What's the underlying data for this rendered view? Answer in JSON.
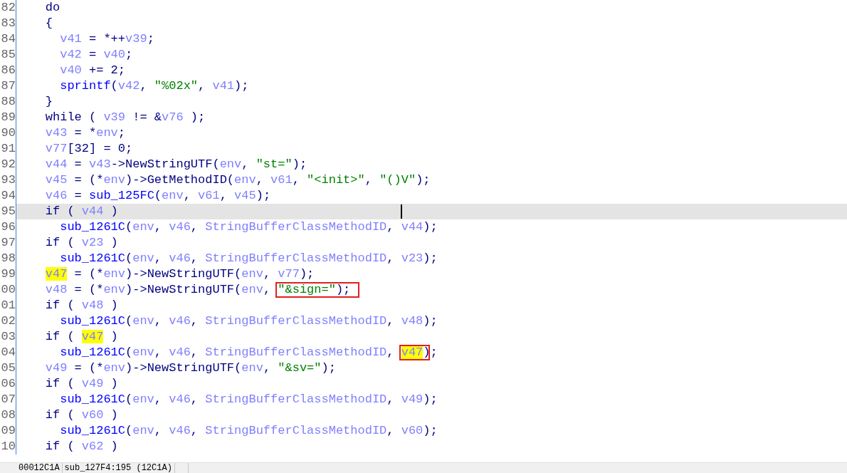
{
  "lines": [
    {
      "number": "82",
      "kind": "outer",
      "current": false,
      "tokens": [
        {
          "kind": "plain",
          "text": "do"
        }
      ]
    },
    {
      "number": "83",
      "kind": "outer",
      "current": false,
      "tokens": [
        {
          "kind": "plain",
          "text": "{"
        }
      ]
    },
    {
      "number": "84",
      "kind": "inner",
      "current": false,
      "tokens": [
        {
          "kind": "var",
          "text": "v41"
        },
        {
          "kind": "plain",
          "text": " = *++"
        },
        {
          "kind": "var",
          "text": "v39"
        },
        {
          "kind": "plain",
          "text": ";"
        }
      ]
    },
    {
      "number": "85",
      "kind": "inner",
      "current": false,
      "tokens": [
        {
          "kind": "var",
          "text": "v42"
        },
        {
          "kind": "plain",
          "text": " = "
        },
        {
          "kind": "var",
          "text": "v40"
        },
        {
          "kind": "plain",
          "text": ";"
        }
      ]
    },
    {
      "number": "86",
      "kind": "inner",
      "current": false,
      "tokens": [
        {
          "kind": "var",
          "text": "v40"
        },
        {
          "kind": "plain",
          "text": " += 2;"
        }
      ]
    },
    {
      "number": "87",
      "kind": "inner",
      "current": false,
      "tokens": [
        {
          "kind": "func",
          "text": "sprintf"
        },
        {
          "kind": "plain",
          "text": "("
        },
        {
          "kind": "var",
          "text": "v42"
        },
        {
          "kind": "plain",
          "text": ", "
        },
        {
          "kind": "string",
          "text": "\"%02x\""
        },
        {
          "kind": "plain",
          "text": ", "
        },
        {
          "kind": "var",
          "text": "v41"
        },
        {
          "kind": "plain",
          "text": ");"
        }
      ]
    },
    {
      "number": "88",
      "kind": "outer",
      "current": false,
      "tokens": [
        {
          "kind": "plain",
          "text": "}"
        }
      ]
    },
    {
      "number": "89",
      "kind": "outer",
      "current": false,
      "tokens": [
        {
          "kind": "plain",
          "text": "while ( "
        },
        {
          "kind": "var",
          "text": "v39"
        },
        {
          "kind": "plain",
          "text": " != &"
        },
        {
          "kind": "var",
          "text": "v76"
        },
        {
          "kind": "plain",
          "text": " );"
        }
      ]
    },
    {
      "number": "90",
      "kind": "outer",
      "current": false,
      "tokens": [
        {
          "kind": "var",
          "text": "v43"
        },
        {
          "kind": "plain",
          "text": " = *"
        },
        {
          "kind": "var",
          "text": "env"
        },
        {
          "kind": "plain",
          "text": ";"
        }
      ]
    },
    {
      "number": "91",
      "kind": "outer",
      "current": false,
      "tokens": [
        {
          "kind": "var",
          "text": "v77"
        },
        {
          "kind": "plain",
          "text": "[32] = 0;"
        }
      ]
    },
    {
      "number": "92",
      "kind": "outer",
      "current": false,
      "tokens": [
        {
          "kind": "var",
          "text": "v44"
        },
        {
          "kind": "plain",
          "text": " = "
        },
        {
          "kind": "var",
          "text": "v43"
        },
        {
          "kind": "plain",
          "text": "->NewStringUTF("
        },
        {
          "kind": "var",
          "text": "env"
        },
        {
          "kind": "plain",
          "text": ", "
        },
        {
          "kind": "string",
          "text": "\"st=\""
        },
        {
          "kind": "plain",
          "text": ");"
        }
      ]
    },
    {
      "number": "93",
      "kind": "outer",
      "current": false,
      "tokens": [
        {
          "kind": "var",
          "text": "v45"
        },
        {
          "kind": "plain",
          "text": " = (*"
        },
        {
          "kind": "var",
          "text": "env"
        },
        {
          "kind": "plain",
          "text": ")->GetMethodID("
        },
        {
          "kind": "var",
          "text": "env"
        },
        {
          "kind": "plain",
          "text": ", "
        },
        {
          "kind": "var",
          "text": "v61"
        },
        {
          "kind": "plain",
          "text": ", "
        },
        {
          "kind": "string",
          "text": "\"<init>\""
        },
        {
          "kind": "plain",
          "text": ", "
        },
        {
          "kind": "string",
          "text": "\"()V\""
        },
        {
          "kind": "plain",
          "text": ");"
        }
      ]
    },
    {
      "number": "94",
      "kind": "outer",
      "current": false,
      "tokens": [
        {
          "kind": "var",
          "text": "v46"
        },
        {
          "kind": "plain",
          "text": " = "
        },
        {
          "kind": "func",
          "text": "sub_125FC"
        },
        {
          "kind": "plain",
          "text": "("
        },
        {
          "kind": "var",
          "text": "env"
        },
        {
          "kind": "plain",
          "text": ", "
        },
        {
          "kind": "var",
          "text": "v61"
        },
        {
          "kind": "plain",
          "text": ", "
        },
        {
          "kind": "var",
          "text": "v45"
        },
        {
          "kind": "plain",
          "text": ");"
        }
      ]
    },
    {
      "number": "95",
      "kind": "outer",
      "current": true,
      "tokens": [
        {
          "kind": "plain",
          "text": "if ( "
        },
        {
          "kind": "var",
          "text": "v44"
        },
        {
          "kind": "plain",
          "text": " )"
        }
      ]
    },
    {
      "number": "96",
      "kind": "inner",
      "current": false,
      "tokens": [
        {
          "kind": "func",
          "text": "sub_1261C"
        },
        {
          "kind": "plain",
          "text": "("
        },
        {
          "kind": "var",
          "text": "env"
        },
        {
          "kind": "plain",
          "text": ", "
        },
        {
          "kind": "var",
          "text": "v46"
        },
        {
          "kind": "plain",
          "text": ", "
        },
        {
          "kind": "var",
          "text": "StringBufferClassMethodID"
        },
        {
          "kind": "plain",
          "text": ", "
        },
        {
          "kind": "var",
          "text": "v44"
        },
        {
          "kind": "plain",
          "text": ");"
        }
      ]
    },
    {
      "number": "97",
      "kind": "outer",
      "current": false,
      "tokens": [
        {
          "kind": "plain",
          "text": "if ( "
        },
        {
          "kind": "var",
          "text": "v23"
        },
        {
          "kind": "plain",
          "text": " )"
        }
      ]
    },
    {
      "number": "98",
      "kind": "inner",
      "current": false,
      "tokens": [
        {
          "kind": "func",
          "text": "sub_1261C"
        },
        {
          "kind": "plain",
          "text": "("
        },
        {
          "kind": "var",
          "text": "env"
        },
        {
          "kind": "plain",
          "text": ", "
        },
        {
          "kind": "var",
          "text": "v46"
        },
        {
          "kind": "plain",
          "text": ", "
        },
        {
          "kind": "var",
          "text": "StringBufferClassMethodID"
        },
        {
          "kind": "plain",
          "text": ", "
        },
        {
          "kind": "var",
          "text": "v23"
        },
        {
          "kind": "plain",
          "text": ");"
        }
      ]
    },
    {
      "number": "99",
      "kind": "outer",
      "current": false,
      "tokens": [
        {
          "kind": "var",
          "text": "v47",
          "highlighted": true
        },
        {
          "kind": "plain",
          "text": " = (*"
        },
        {
          "kind": "var",
          "text": "env"
        },
        {
          "kind": "plain",
          "text": ")->NewStringUTF("
        },
        {
          "kind": "var",
          "text": "env"
        },
        {
          "kind": "plain",
          "text": ", "
        },
        {
          "kind": "var",
          "text": "v77"
        },
        {
          "kind": "plain",
          "text": ");"
        }
      ]
    },
    {
      "number": "00",
      "kind": "outer",
      "current": false,
      "tokens": [
        {
          "kind": "var",
          "text": "v48"
        },
        {
          "kind": "plain",
          "text": " = (*"
        },
        {
          "kind": "var",
          "text": "env"
        },
        {
          "kind": "plain",
          "text": ")->NewStringUTF("
        },
        {
          "kind": "var",
          "text": "env"
        },
        {
          "kind": "plain",
          "text": ", "
        },
        {
          "kind": "string",
          "text": "\"&sign=\"",
          "boxed": true
        },
        {
          "kind": "plain",
          "text": ");",
          "boxed": true
        }
      ]
    },
    {
      "number": "01",
      "kind": "outer",
      "current": false,
      "tokens": [
        {
          "kind": "plain",
          "text": "if ( "
        },
        {
          "kind": "var",
          "text": "v48"
        },
        {
          "kind": "plain",
          "text": " )"
        }
      ]
    },
    {
      "number": "02",
      "kind": "inner",
      "current": false,
      "tokens": [
        {
          "kind": "func",
          "text": "sub_1261C"
        },
        {
          "kind": "plain",
          "text": "("
        },
        {
          "kind": "var",
          "text": "env"
        },
        {
          "kind": "plain",
          "text": ", "
        },
        {
          "kind": "var",
          "text": "v46"
        },
        {
          "kind": "plain",
          "text": ", "
        },
        {
          "kind": "var",
          "text": "StringBufferClassMethodID"
        },
        {
          "kind": "plain",
          "text": ", "
        },
        {
          "kind": "var",
          "text": "v48"
        },
        {
          "kind": "plain",
          "text": ");"
        }
      ]
    },
    {
      "number": "03",
      "kind": "outer",
      "current": false,
      "tokens": [
        {
          "kind": "plain",
          "text": "if ( "
        },
        {
          "kind": "var",
          "text": "v47",
          "highlighted": true
        },
        {
          "kind": "plain",
          "text": " )"
        }
      ]
    },
    {
      "number": "04",
      "kind": "inner",
      "current": false,
      "tokens": [
        {
          "kind": "func",
          "text": "sub_1261C"
        },
        {
          "kind": "plain",
          "text": "("
        },
        {
          "kind": "var",
          "text": "env"
        },
        {
          "kind": "plain",
          "text": ", "
        },
        {
          "kind": "var",
          "text": "v46"
        },
        {
          "kind": "plain",
          "text": ", "
        },
        {
          "kind": "var",
          "text": "StringBufferClassMethodID"
        },
        {
          "kind": "plain",
          "text": ", "
        },
        {
          "kind": "var",
          "text": "v47",
          "highlighted": true,
          "boxed": true
        },
        {
          "kind": "plain",
          "text": ")",
          "boxed": true
        },
        {
          "kind": "plain",
          "text": ";"
        }
      ]
    },
    {
      "number": "05",
      "kind": "outer",
      "current": false,
      "tokens": [
        {
          "kind": "var",
          "text": "v49"
        },
        {
          "kind": "plain",
          "text": " = (*"
        },
        {
          "kind": "var",
          "text": "env"
        },
        {
          "kind": "plain",
          "text": ")->NewStringUTF("
        },
        {
          "kind": "var",
          "text": "env"
        },
        {
          "kind": "plain",
          "text": ", "
        },
        {
          "kind": "string",
          "text": "\"&sv=\""
        },
        {
          "kind": "plain",
          "text": ");"
        }
      ]
    },
    {
      "number": "06",
      "kind": "outer",
      "current": false,
      "tokens": [
        {
          "kind": "plain",
          "text": "if ( "
        },
        {
          "kind": "var",
          "text": "v49"
        },
        {
          "kind": "plain",
          "text": " )"
        }
      ]
    },
    {
      "number": "07",
      "kind": "inner",
      "current": false,
      "tokens": [
        {
          "kind": "func",
          "text": "sub_1261C"
        },
        {
          "kind": "plain",
          "text": "("
        },
        {
          "kind": "var",
          "text": "env"
        },
        {
          "kind": "plain",
          "text": ", "
        },
        {
          "kind": "var",
          "text": "v46"
        },
        {
          "kind": "plain",
          "text": ", "
        },
        {
          "kind": "var",
          "text": "StringBufferClassMethodID"
        },
        {
          "kind": "plain",
          "text": ", "
        },
        {
          "kind": "var",
          "text": "v49"
        },
        {
          "kind": "plain",
          "text": ");"
        }
      ]
    },
    {
      "number": "08",
      "kind": "outer",
      "current": false,
      "tokens": [
        {
          "kind": "plain",
          "text": "if ( "
        },
        {
          "kind": "var",
          "text": "v60"
        },
        {
          "kind": "plain",
          "text": " )"
        }
      ]
    },
    {
      "number": "09",
      "kind": "inner",
      "current": false,
      "tokens": [
        {
          "kind": "func",
          "text": "sub_1261C"
        },
        {
          "kind": "plain",
          "text": "("
        },
        {
          "kind": "var",
          "text": "env"
        },
        {
          "kind": "plain",
          "text": ", "
        },
        {
          "kind": "var",
          "text": "v46"
        },
        {
          "kind": "plain",
          "text": ", "
        },
        {
          "kind": "var",
          "text": "StringBufferClassMethodID"
        },
        {
          "kind": "plain",
          "text": ", "
        },
        {
          "kind": "var",
          "text": "v60"
        },
        {
          "kind": "plain",
          "text": ");"
        }
      ]
    },
    {
      "number": "10",
      "kind": "outer",
      "current": false,
      "tokens": [
        {
          "kind": "plain",
          "text": "if ( "
        },
        {
          "kind": "var",
          "text": "v62"
        },
        {
          "kind": "plain",
          "text": " )"
        }
      ]
    }
  ],
  "status_bar": [
    "00012C1A",
    "sub_127F4:195 (12C1A)"
  ]
}
